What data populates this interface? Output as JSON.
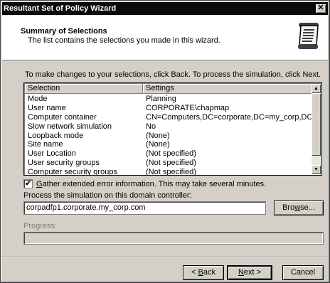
{
  "window": {
    "title": "Resultant Set of Policy Wizard",
    "close_glyph": "✕"
  },
  "header": {
    "title": "Summary of Selections",
    "subtitle": "The list contains the selections you made in this wizard.",
    "icon": "scroll-document-icon"
  },
  "instruction": "To make changes to your selections, click Back. To process the simulation, click Next.",
  "list": {
    "columns": [
      "Selection",
      "Settings"
    ],
    "rows": [
      {
        "selection": "Mode",
        "setting": "Planning"
      },
      {
        "selection": "User name",
        "setting": "CORPORATE\\chapmap"
      },
      {
        "selection": "Computer container",
        "setting": "CN=Computers,DC=corporate,DC=my_corp,DC=com"
      },
      {
        "selection": "Slow network simulation",
        "setting": "No"
      },
      {
        "selection": "Loopback mode",
        "setting": "(None)"
      },
      {
        "selection": "Site name",
        "setting": "(None)"
      },
      {
        "selection": "User Location",
        "setting": "(Not specified)"
      },
      {
        "selection": "User security groups",
        "setting": "(Not specified)"
      },
      {
        "selection": "Computer security groups",
        "setting": "(Not specified)"
      }
    ]
  },
  "gather_checkbox": {
    "checked": true,
    "mark": "✔",
    "label_mnemonic": "G",
    "label_rest": "ather extended error information. This may take several minutes."
  },
  "domain_controller": {
    "label": "Process the simulation on this domain controller:",
    "value": "corpadfp1.corporate.my_corp.com"
  },
  "buttons": {
    "browse": {
      "mnemonic": "w",
      "pre": "Bro",
      "post": "se..."
    },
    "back": {
      "pre": "< ",
      "mnemonic": "B",
      "post": "ack"
    },
    "next": {
      "pre": "",
      "mnemonic": "N",
      "post": "ext >"
    },
    "cancel": "Cancel"
  },
  "progress": {
    "label": "Progress:",
    "value": 0
  }
}
